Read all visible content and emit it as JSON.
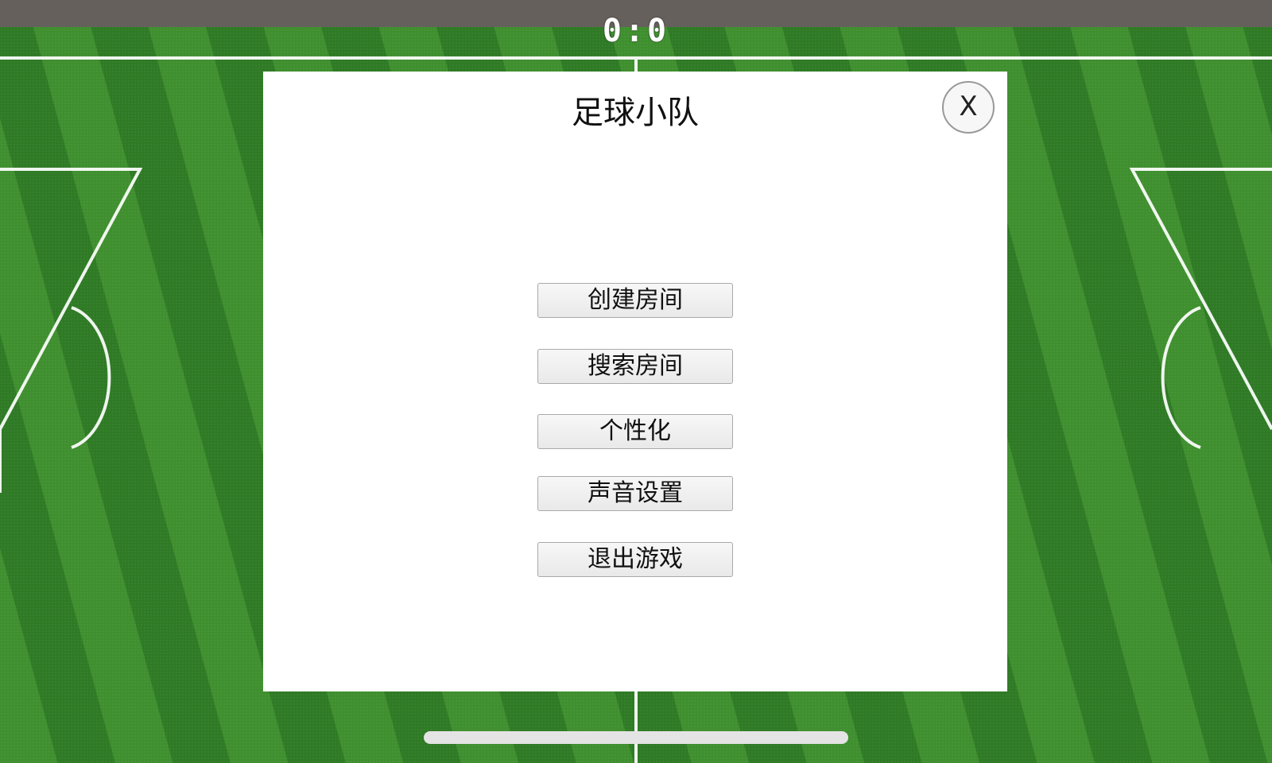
{
  "score": "0:0",
  "menu": {
    "title": "足球小队",
    "close_label": "X",
    "buttons": [
      {
        "label": "创建房间"
      },
      {
        "label": "搜索房间"
      },
      {
        "label": "个性化"
      },
      {
        "label": "声音设置"
      },
      {
        "label": "退出游戏"
      }
    ]
  },
  "colors": {
    "grass_light": "#3f8f2f",
    "grass_dark": "#2f7a25",
    "top_bar": "#66605c",
    "panel": "#ffffff"
  }
}
